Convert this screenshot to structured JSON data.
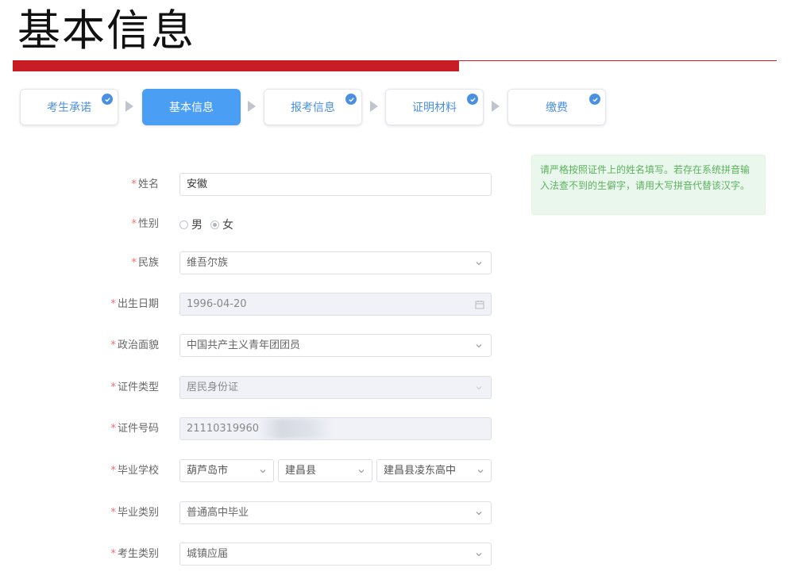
{
  "page": {
    "title": "基本信息"
  },
  "steps": [
    {
      "label": "考生承诺",
      "checked": true
    },
    {
      "label": "基本信息",
      "checked": false,
      "active": true
    },
    {
      "label": "报考信息",
      "checked": true
    },
    {
      "label": "证明材料",
      "checked": true
    },
    {
      "label": "缴费",
      "checked": true
    }
  ],
  "tip": {
    "text": "请严格按照证件上的姓名填写。若存在系统拼音输入法查不到的生僻字，请用大写拼音代替该汉字。"
  },
  "form": {
    "required_mark": "*",
    "name": {
      "label": "姓名",
      "value": "安徽"
    },
    "gender": {
      "label": "性别",
      "options": [
        "男",
        "女"
      ],
      "selected": "女"
    },
    "ethnicity": {
      "label": "民族",
      "value": "维吾尔族"
    },
    "birthdate": {
      "label": "出生日期",
      "value": "1996-04-20"
    },
    "political": {
      "label": "政治面貌",
      "value": "中国共产主义青年团团员"
    },
    "id_type": {
      "label": "证件类型",
      "value": "居民身份证"
    },
    "id_number": {
      "label": "证件号码",
      "value": "21110319960"
    },
    "school": {
      "label": "毕业学校",
      "city": "葫芦岛市",
      "county": "建昌县",
      "school": "建昌县凌东高中"
    },
    "grad_type": {
      "label": "毕业类别",
      "value": "普通高中毕业"
    },
    "candidate_type": {
      "label": "考生类别",
      "value": "城镇应届"
    }
  },
  "colors": {
    "accent": "#4a90e2",
    "brand_red": "#c81d25",
    "tip_bg": "#eaf7ec",
    "tip_text": "#5cb15f",
    "required": "#f56c6c"
  }
}
